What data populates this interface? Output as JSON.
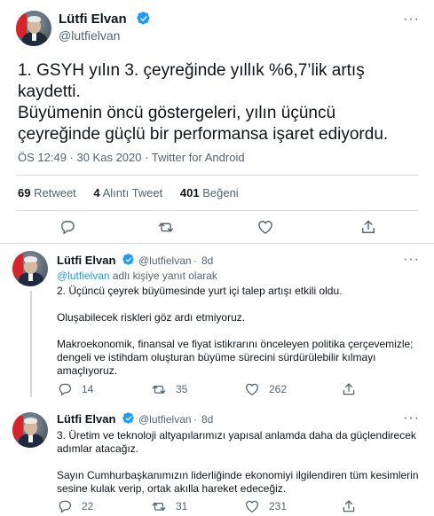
{
  "main_tweet": {
    "author_name": "Lütfi Elvan",
    "author_handle": "@lutfielvan",
    "more_label": "···",
    "paragraphs": [
      "1. GSYH yılın 3. çeyreğinde yıllık %6,7’lik artış kaydetti.",
      "Büyümenin öncü göstergeleri, yılın üçüncü çeyreğinde güçlü bir performansa işaret ediyordu."
    ],
    "meta": "ÖS 12:49 · 30 Kas 2020 · Twitter for Android",
    "stats": {
      "retweets_count": "69",
      "retweets_label": "Retweet",
      "quotes_count": "4",
      "quotes_label": "Alıntı Tweet",
      "likes_count": "401",
      "likes_label": "Beğeni"
    }
  },
  "replies": [
    {
      "author_name": "Lütfi Elvan",
      "author_handle": "@lutfielvan",
      "time": "8d",
      "separator": "·",
      "replying_link": "@lutfielvan",
      "replying_text": " adlı kişiye yanıt olarak",
      "paragraphs": [
        "2. Üçüncü çeyrek büyümesinde yurt içi talep artışı etkili oldu.",
        "Oluşabilecek riskleri göz ardı etmiyoruz.",
        "Makroekonomik, finansal ve fiyat istikrarını önceleyen politika çerçevemizle; dengeli ve istihdam oluşturan büyüme sürecini sürdürülebilir kılmayı amaçlıyoruz."
      ],
      "reply_count": "14",
      "retweet_count": "35",
      "like_count": "262"
    },
    {
      "author_name": "Lütfi Elvan",
      "author_handle": "@lutfielvan",
      "time": "8d",
      "separator": "·",
      "paragraphs": [
        "3. Üretim ve teknoloji altyapılarımızı yapısal anlamda daha da güçlendirecek adımlar atacağız.",
        "Sayın Cumhurbaşkanımızın liderliğinde ekonomiyi ilgilendiren tüm kesimlerin sesine kulak verip, ortak akılla hareket edeceğiz."
      ],
      "reply_count": "22",
      "retweet_count": "31",
      "like_count": "231"
    }
  ],
  "icons": {
    "reply": "reply-icon",
    "retweet": "retweet-icon",
    "like": "heart-icon",
    "share": "share-icon",
    "verified": "verified-badge-icon"
  },
  "colors": {
    "accent": "#1d9bf0",
    "secondary_text": "#536471",
    "divider": "#cfd9de"
  }
}
